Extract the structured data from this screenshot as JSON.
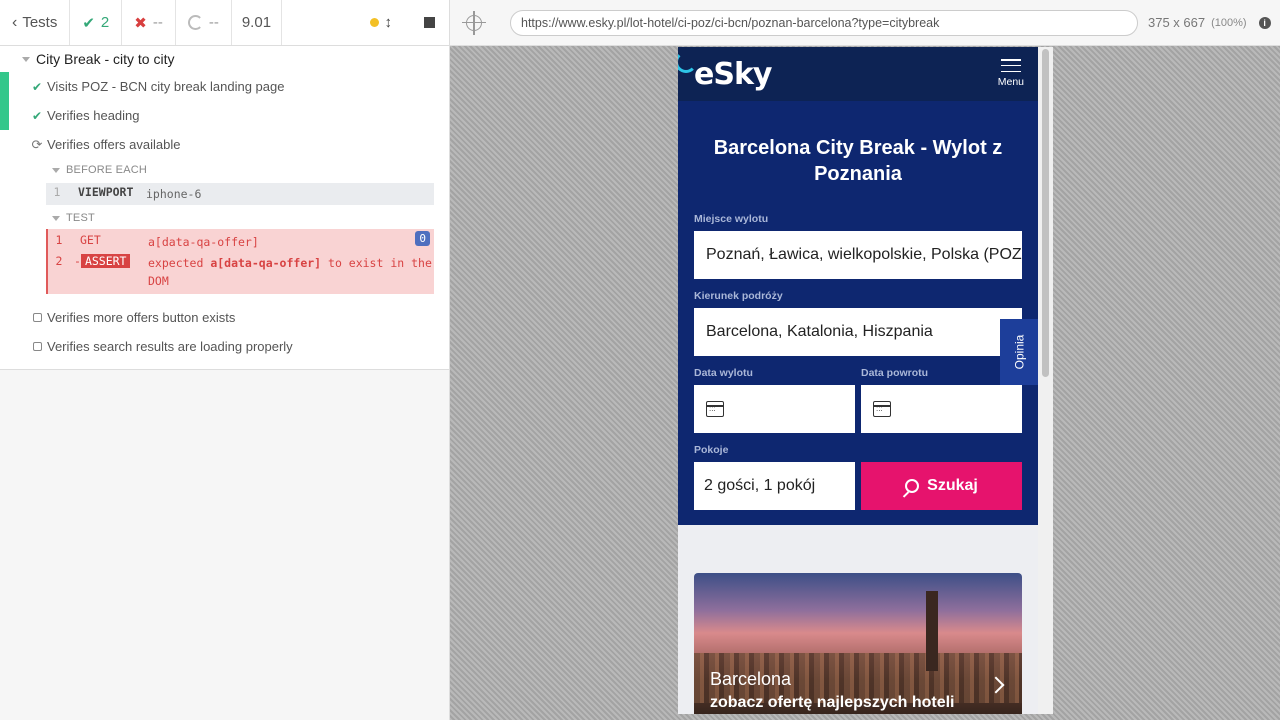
{
  "reporter": {
    "tests_label": "Tests",
    "passed_count": "2",
    "failed_count": "--",
    "pending_count": "--",
    "duration": "9.01",
    "suite_title": "City Break - city to city",
    "tests": [
      {
        "title": "Visits POZ - BCN city break landing page",
        "state": "passed"
      },
      {
        "title": "Verifies heading",
        "state": "passed"
      },
      {
        "title": "Verifies offers available",
        "state": "running"
      },
      {
        "title": "Verifies more offers button exists",
        "state": "pending"
      },
      {
        "title": "Verifies search results are loading properly",
        "state": "pending"
      }
    ],
    "before_each_label": "BEFORE EACH",
    "test_label": "TEST",
    "viewport_cmd": {
      "num": "1",
      "name": "VIEWPORT",
      "message": "iphone-6"
    },
    "get_cmd": {
      "num": "1",
      "name": "GET",
      "message": "a[data-qa-offer]",
      "badge": "0"
    },
    "assert_cmd": {
      "num": "2",
      "dash": "-",
      "name": "ASSERT",
      "message_pre": "expected ",
      "message_bold": "a[data-qa-offer]",
      "message_post": " to exist in the DOM"
    }
  },
  "url_bar": {
    "url": "https://www.esky.pl/lot-hotel/ci-poz/ci-bcn/poznan-barcelona?type=citybreak",
    "viewport_size": "375 x 667",
    "zoom": "(100%)"
  },
  "esky": {
    "logo": "eSky",
    "menu_label": "Menu",
    "heading": "Barcelona City Break - Wylot z Poznania",
    "departure_label": "Miejsce wylotu",
    "departure_value": "Poznań, Ławica, wielkopolskie, Polska (POZ)",
    "destination_label": "Kierunek podróży",
    "destination_value": "Barcelona, Katalonia, Hiszpania",
    "depart_date_label": "Data wylotu",
    "return_date_label": "Data powrotu",
    "rooms_label": "Pokoje",
    "rooms_value": "2 gości, 1 pokój",
    "search_button": "Szukaj",
    "feedback_tab": "Opinia",
    "hero_city": "Barcelona",
    "hero_cta": "zobacz ofertę najlepszych hoteli"
  },
  "colors": {
    "esky_header": "#0d2354",
    "esky_panel": "#0e2770",
    "search_button": "#e6136d",
    "pass_green": "#34a878",
    "fail_red": "#d84343"
  }
}
